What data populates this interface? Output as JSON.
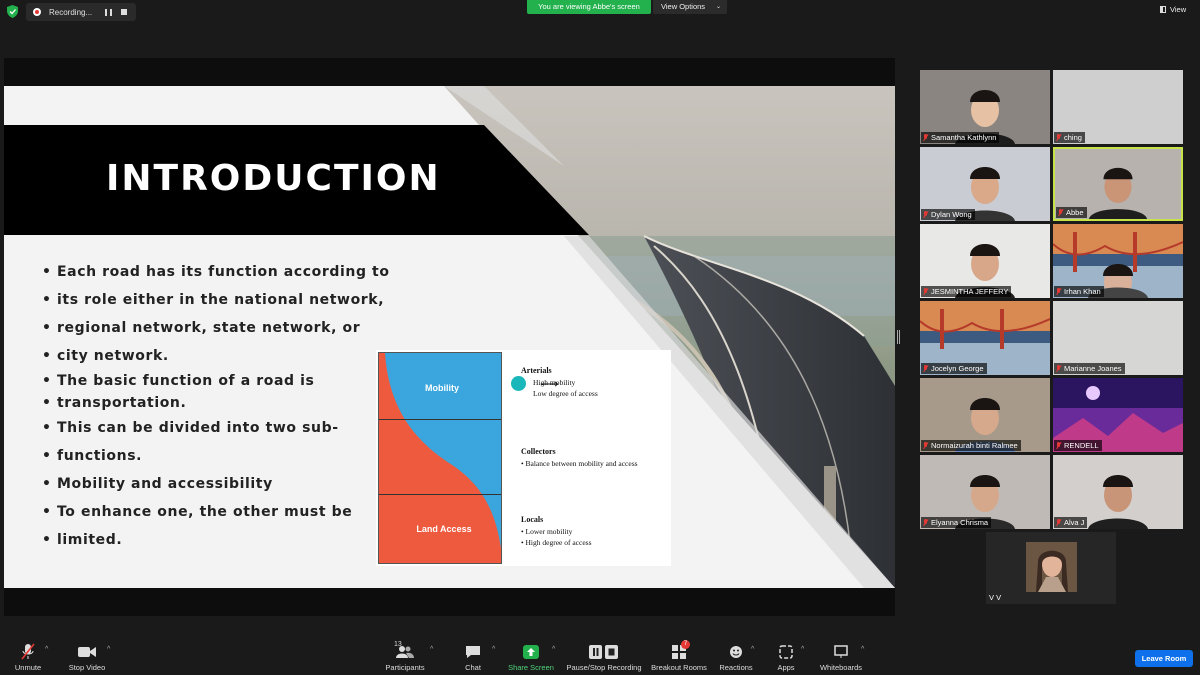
{
  "topbar": {
    "recording_label": "Recording...",
    "viewing_banner": "You are viewing Abbe's screen",
    "view_options_label": "View Options",
    "view_label": "View"
  },
  "slide": {
    "title": "INTRODUCTION",
    "bullets": [
      "Each road has its function according to",
      "its role either in the national network,",
      "regional network, state network, or",
      "city network.",
      "The basic function of a road is",
      "transportation.",
      "This can be divided into two sub-",
      "functions.",
      "Mobility and accessibility",
      "To enhance one, the other must be",
      "limited."
    ],
    "diagram": {
      "mobility_label": "Mobility",
      "land_access_label": "Land Access",
      "arterials_heading": "Arterials",
      "arterials_items": [
        "High mobility",
        "Low degree of access"
      ],
      "collectors_heading": "Collectors",
      "collectors_items": [
        "• Balance between mobility and access"
      ],
      "locals_heading": "Locals",
      "locals_items": [
        "• Lower mobility",
        "• High degree of access"
      ]
    }
  },
  "participants": [
    {
      "name": "Samantha Kathlynn"
    },
    {
      "name": "ching"
    },
    {
      "name": "Dylan Wong"
    },
    {
      "name": "Abbe"
    },
    {
      "name": "JESMINTHA JEFFERY"
    },
    {
      "name": "Irhan Khan"
    },
    {
      "name": "Jocelyn George"
    },
    {
      "name": "Marianne Joanes"
    },
    {
      "name": "Normaizurah binti Ralmee"
    },
    {
      "name": "RENDELL"
    },
    {
      "name": "Elyanna Chrisma"
    },
    {
      "name": "Alva J"
    },
    {
      "name": "V V"
    }
  ],
  "toolbar": {
    "unmute": "Unmute",
    "stop_video": "Stop Video",
    "participants": "Participants",
    "participants_count": "13",
    "chat": "Chat",
    "share_screen": "Share Screen",
    "pause_stop_recording": "Pause/Stop Recording",
    "breakout_rooms": "Breakout Rooms",
    "breakout_badge": "7",
    "reactions": "Reactions",
    "apps": "Apps",
    "whiteboards": "Whiteboards",
    "leave_room": "Leave Room"
  },
  "colors": {
    "accent_green": "#23b14d",
    "leave_blue": "#0e71eb",
    "active_speaker": "#c7e34a",
    "mobility_blue": "#3aa6dd",
    "land_access_red": "#ee5a3e"
  }
}
